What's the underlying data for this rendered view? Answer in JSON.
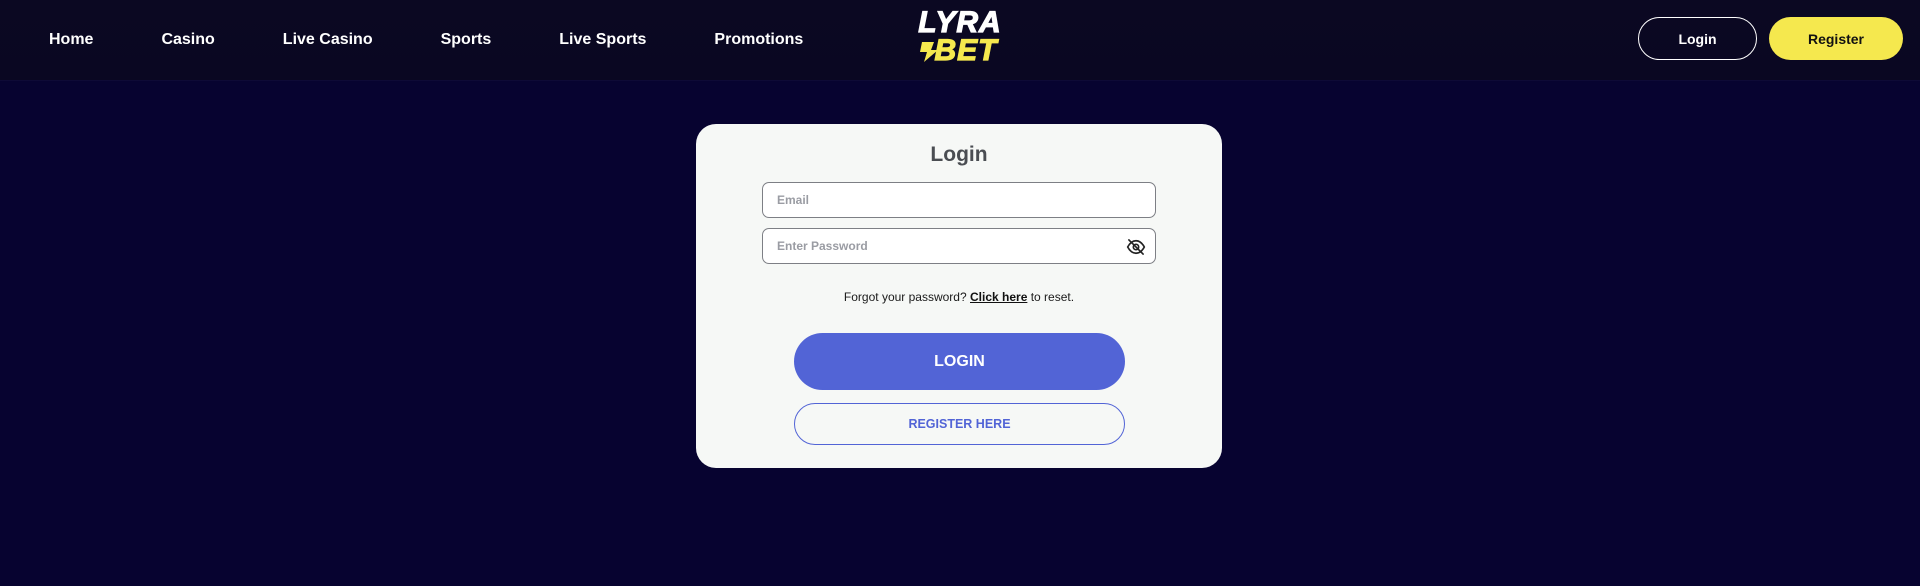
{
  "nav": {
    "items": [
      {
        "label": "Home"
      },
      {
        "label": "Casino"
      },
      {
        "label": "Live Casino"
      },
      {
        "label": "Sports"
      },
      {
        "label": "Live Sports"
      },
      {
        "label": "Promotions"
      }
    ]
  },
  "brand": {
    "logo_top": "LYRA",
    "logo_bottom": "BET",
    "logo_color_top": "#ffffff",
    "logo_color_bottom": "#f5e84e"
  },
  "header_actions": {
    "login_label": "Login",
    "register_label": "Register"
  },
  "login_card": {
    "title": "Login",
    "email_placeholder": "Email",
    "password_placeholder": "Enter Password",
    "password_toggle_icon": "eye-slash-icon",
    "forgot_prefix": "Forgot your password?",
    "forgot_link": "Click here",
    "forgot_suffix": "to reset.",
    "login_button": "LOGIN",
    "register_button": "REGISTER HERE"
  },
  "colors": {
    "page_background": "#070330",
    "header_background": "#0b0822",
    "accent_yellow": "#f5e84e",
    "primary_blue": "#5264d6",
    "card_background": "#f6f8f6"
  }
}
